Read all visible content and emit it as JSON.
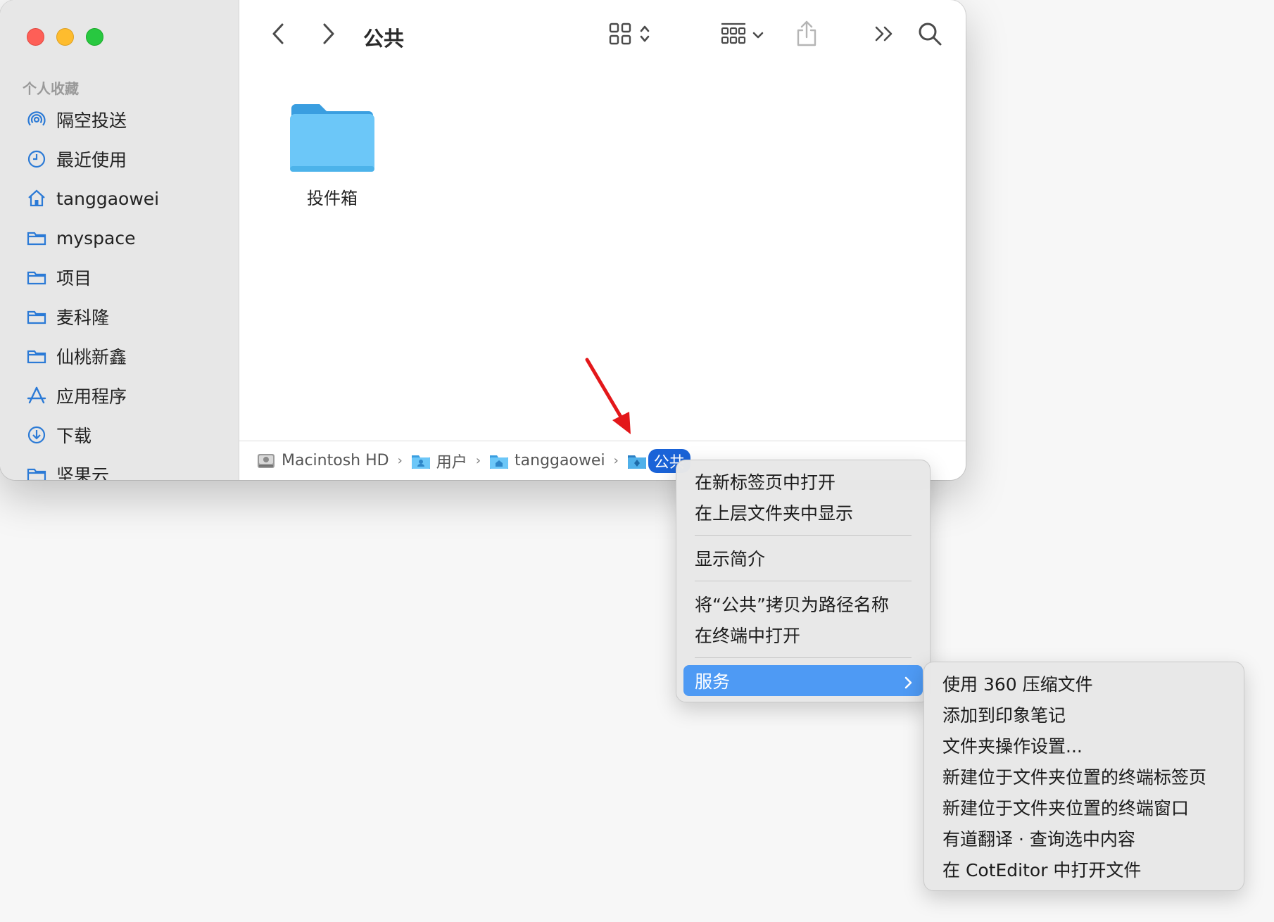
{
  "window": {
    "title": "公共",
    "sidebar": {
      "heading": "个人收藏",
      "items": [
        {
          "label": "隔空投送",
          "icon": "airdrop-icon"
        },
        {
          "label": "最近使用",
          "icon": "clock-icon"
        },
        {
          "label": "tanggaowei",
          "icon": "home-icon"
        },
        {
          "label": "myspace",
          "icon": "folder-icon"
        },
        {
          "label": "项目",
          "icon": "folder-icon"
        },
        {
          "label": "麦科隆",
          "icon": "folder-icon"
        },
        {
          "label": "仙桃新鑫",
          "icon": "folder-icon"
        },
        {
          "label": "应用程序",
          "icon": "applications-icon"
        },
        {
          "label": "下载",
          "icon": "download-icon"
        },
        {
          "label": "坚果云",
          "icon": "folder-icon"
        }
      ]
    },
    "content": {
      "items": [
        {
          "label": "投件箱",
          "icon": "folder-icon"
        }
      ]
    },
    "pathbar": {
      "crumbs": [
        {
          "label": "Macintosh HD",
          "icon": "hard-drive-icon"
        },
        {
          "label": "用户",
          "icon": "users-folder-icon"
        },
        {
          "label": "tanggaowei",
          "icon": "home-folder-icon"
        },
        {
          "label": "公共",
          "icon": "public-folder-icon"
        }
      ],
      "separator": "›"
    }
  },
  "context_menu": {
    "groups": [
      [
        "在新标签页中打开",
        "在上层文件夹中显示"
      ],
      [
        "显示简介"
      ],
      [
        "将“公共”拷贝为路径名称",
        "在终端中打开"
      ]
    ],
    "services_label": "服务"
  },
  "services_submenu": {
    "items": [
      "使用 360 压缩文件",
      "添加到印象笔记",
      "文件夹操作设置...",
      "新建位于文件夹位置的终端标签页",
      "新建位于文件夹位置的终端窗口",
      "有道翻译 · 查询选中内容",
      "在 CotEditor 中打开文件"
    ]
  },
  "colors": {
    "accent": "#4e9af4",
    "selection": "#1a63d8",
    "sidebar_icon": "#2b7ad6",
    "folder": "#6cc7f8",
    "annotation_arrow": "#e3171a"
  }
}
